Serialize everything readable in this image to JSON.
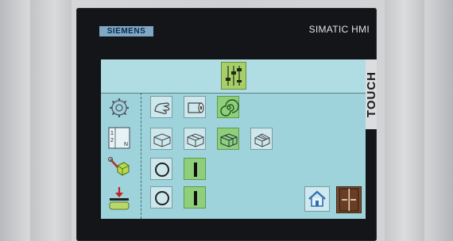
{
  "device": {
    "brand": "SIEMENS",
    "model": "SIMATIC HMI",
    "touch_label": "TOUCH"
  },
  "colors": {
    "screen_bg": "#9ed3db",
    "active_green": "#8fcf7c",
    "frame": "#141518",
    "brand_badge": "#7fa8c4"
  },
  "screen": {
    "title_icon": "fader-panel-icon",
    "left_panel": [
      {
        "icon": "gear-outline-icon"
      },
      {
        "icon": "layout-numbers-icon",
        "labels": [
          "1",
          "2",
          "N"
        ]
      },
      {
        "icon": "wrench-cube-icon"
      },
      {
        "icon": "press-down-icon"
      }
    ],
    "rows": [
      [
        {
          "icon": "hand-icon",
          "active": false
        },
        {
          "icon": "roll-icon",
          "active": false
        },
        {
          "icon": "spiral-icon",
          "active": true
        }
      ],
      [
        {
          "icon": "box-1-icon",
          "active": false
        },
        {
          "icon": "box-2-icon",
          "active": false
        },
        {
          "icon": "box-3-icon",
          "active": true
        },
        {
          "icon": "box-4-icon",
          "active": false
        }
      ],
      [
        {
          "icon": "off-circle-icon",
          "active": false
        },
        {
          "icon": "on-bar-icon",
          "active": true
        }
      ],
      [
        {
          "icon": "off-circle-icon",
          "active": false
        },
        {
          "icon": "on-bar-icon",
          "active": true
        }
      ]
    ],
    "nav": {
      "home_icon": "home-icon",
      "exit_icon": "exit-door-icon"
    }
  }
}
